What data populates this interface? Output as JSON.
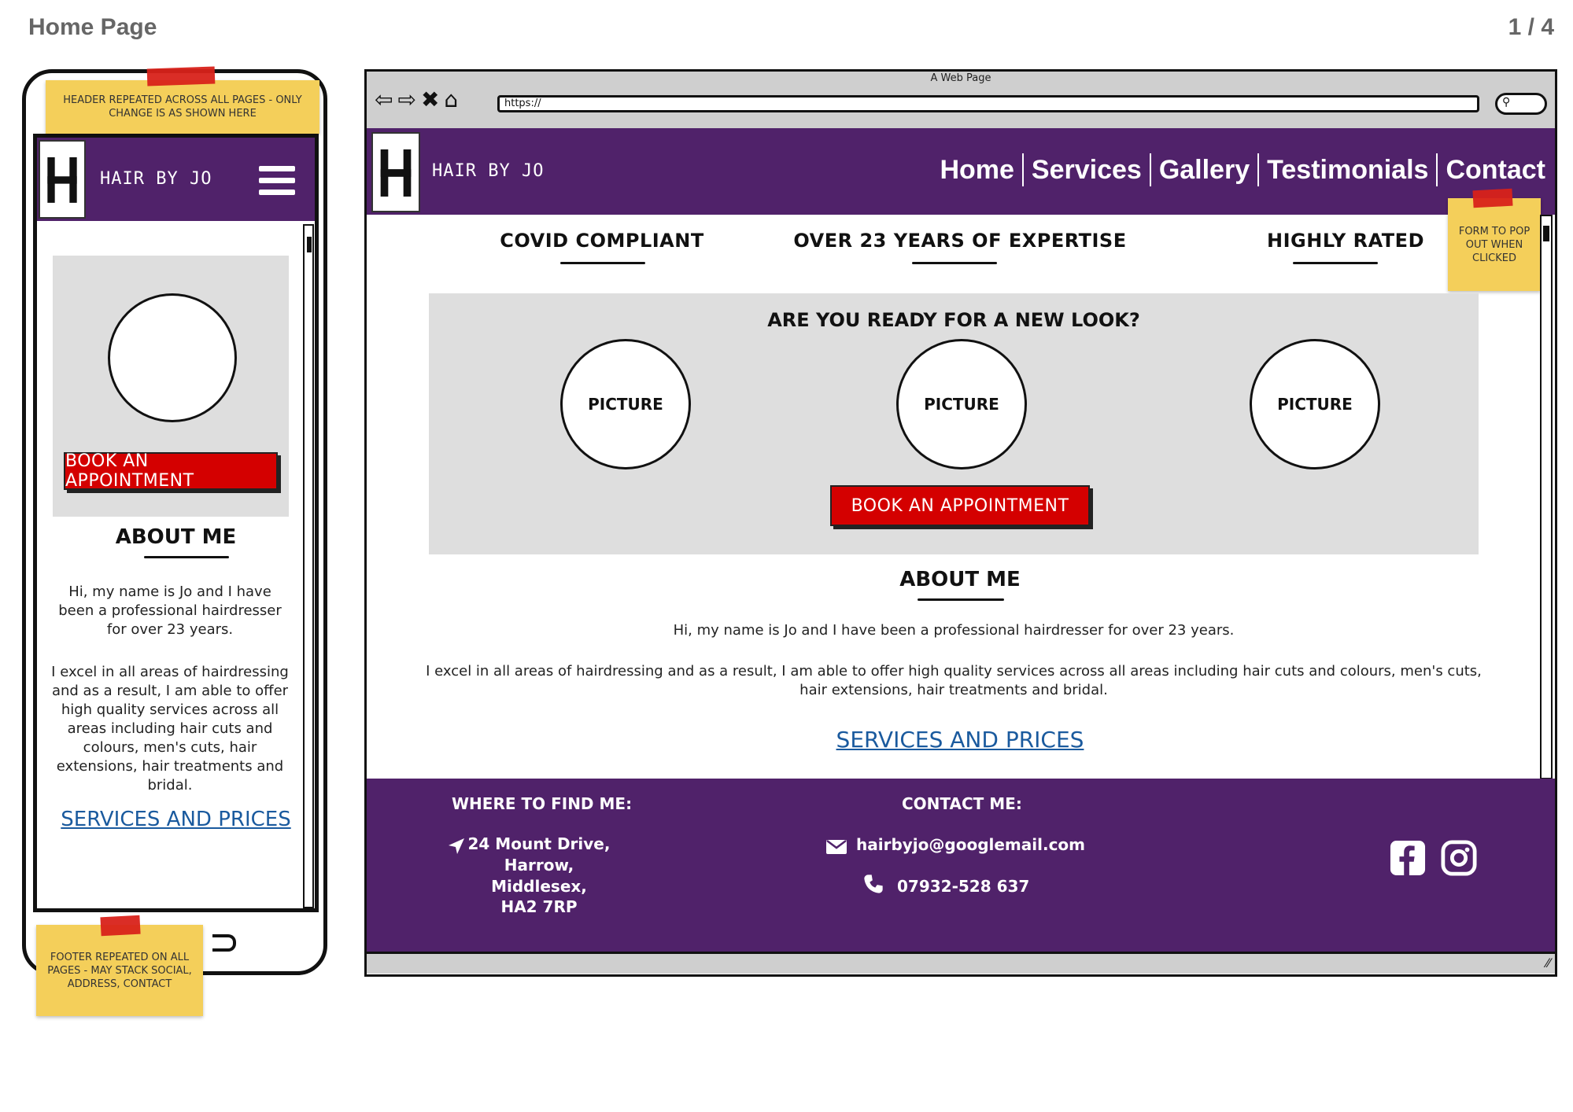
{
  "page": {
    "title": "Home Page",
    "page_indicator": "1 / 4"
  },
  "notes": {
    "header": "HEADER REPEATED ACROSS ALL PAGES - ONLY CHANGE IS AS SHOWN HERE",
    "footer": "FOOTER REPEATED ON ALL PAGES - MAY STACK SOCIAL, ADDRESS, CONTACT",
    "form": "FORM TO POP OUT WHEN CLICKED"
  },
  "mobile": {
    "brand": "HAIR BY JO",
    "book_button": "BOOK AN APPOINTMENT",
    "about_heading": "ABOUT ME",
    "about_p1": "Hi, my name is Jo and I have been a professional hairdresser for over 23 years.",
    "about_p2": "I excel in all areas of hairdressing and as a result, I am able to offer high quality services across all areas including hair cuts and colours, men's cuts, hair extensions, hair treatments and bridal.",
    "services_link": "SERVICES AND PRICES"
  },
  "browser": {
    "window_title": "A Web Page",
    "url": "https://",
    "brand": "HAIR BY JO",
    "nav": [
      "Home",
      "Services",
      "Gallery",
      "Testimonials",
      "Contact"
    ],
    "features": [
      "COVID COMPLIANT",
      "OVER 23 YEARS OF EXPERTISE",
      "HIGHLY RATED"
    ],
    "hero_heading": "ARE YOU READY FOR A NEW LOOK?",
    "pictures": [
      "PICTURE",
      "PICTURE",
      "PICTURE"
    ],
    "book_button": "BOOK AN APPOINTMENT",
    "about_heading": "ABOUT ME",
    "about_p1": "Hi, my name is Jo and I have been a professional hairdresser for over 23 years.",
    "about_p2": "I excel in all areas of hairdressing and as a result, I am able to offer high quality services across all areas including hair cuts and colours, men's cuts, hair extensions, hair treatments and bridal.",
    "services_link": "SERVICES AND PRICES",
    "footer": {
      "where_heading": "WHERE TO FIND ME:",
      "address": [
        "24 Mount Drive,",
        "Harrow,",
        "Middlesex,",
        "HA2 7RP"
      ],
      "contact_heading": "CONTACT ME:",
      "email": "hairbyjo@googlemail.com",
      "phone": "07932-528 637"
    }
  },
  "colors": {
    "brand_purple": "#50226a",
    "button_red": "#d40000",
    "link_blue": "#1a5a9e",
    "sticky_yellow": "#f4cf5a"
  },
  "icons": [
    "back-arrow-icon",
    "forward-arrow-icon",
    "close-icon",
    "home-icon",
    "search-icon",
    "hamburger-menu-icon",
    "location-arrow-icon",
    "envelope-icon",
    "phone-icon",
    "facebook-icon",
    "instagram-icon"
  ]
}
